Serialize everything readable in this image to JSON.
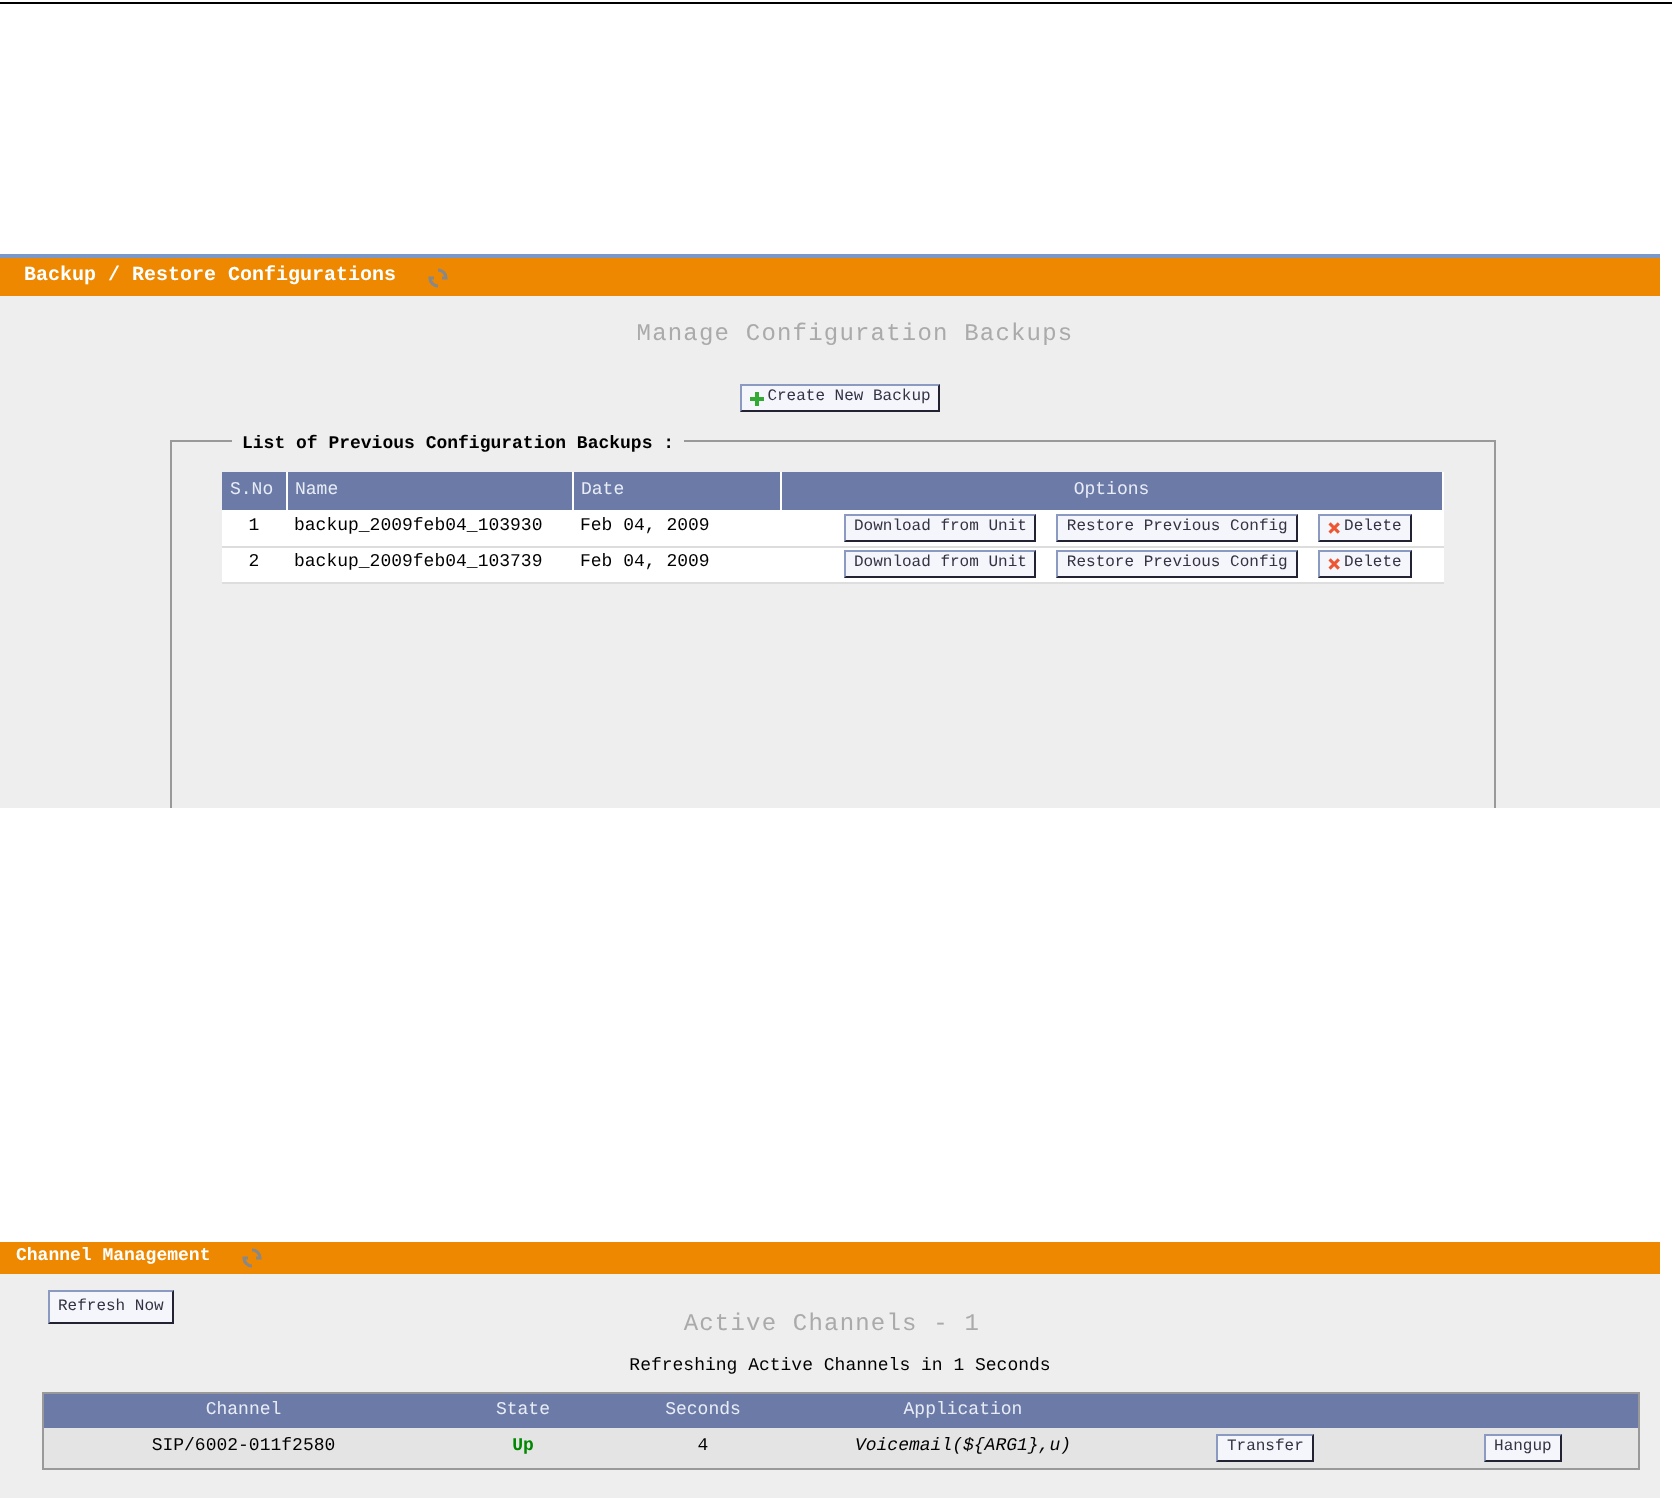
{
  "backup_panel": {
    "title": "Backup / Restore Configurations",
    "heading": "Manage Configuration Backups",
    "create_button": "Create New Backup",
    "list_title": "List of Previous Configuration Backups :",
    "columns": [
      "S.No",
      "Name",
      "Date",
      "Options"
    ],
    "rows": [
      {
        "number": "1",
        "name": "backup_2009feb04_103930",
        "date": "Feb 04, 2009",
        "download": "Download from Unit",
        "restore": "Restore Previous Config",
        "delete": "Delete"
      },
      {
        "number": "2",
        "name": "backup_2009feb04_103739",
        "date": "Feb 04, 2009",
        "download": "Download from Unit",
        "restore": "Restore Previous Config",
        "delete": "Delete"
      }
    ]
  },
  "channel_panel": {
    "title": "Channel Management",
    "refresh_button": "Refresh Now",
    "heading": "Active Channels - 1",
    "refresh_note": "Refreshing Active Channels in 1 Seconds",
    "columns": [
      "Channel",
      "State",
      "Seconds",
      "Application"
    ],
    "rows": [
      {
        "channel": "SIP/6002-011f2580",
        "state": "Up",
        "seconds": "4",
        "application": "Voicemail(${ARG1},u)",
        "transfer": "Transfer",
        "hangup": "Hangup"
      }
    ]
  }
}
